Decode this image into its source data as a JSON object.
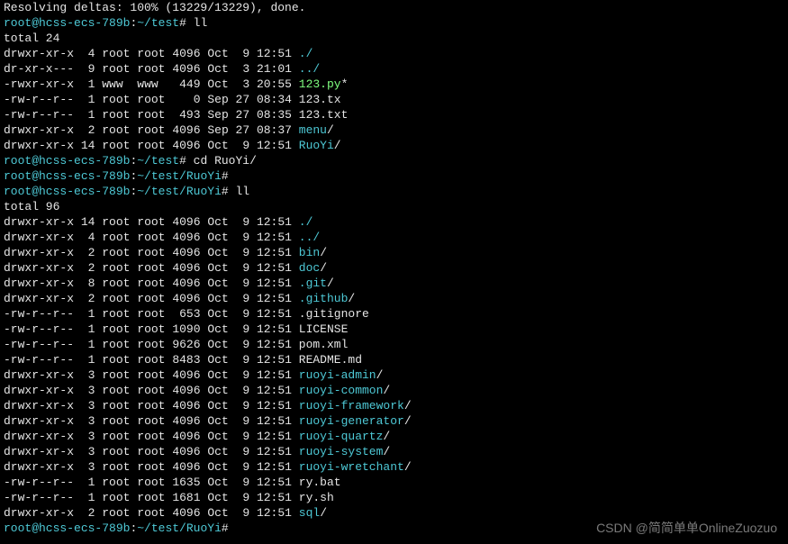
{
  "header_line": {
    "text": "Resolving deltas: 100% (13229/13229), done."
  },
  "prompt1": {
    "user": "root",
    "host": "hcss-ecs-789b",
    "path": "~/test",
    "symbol": "#",
    "cmd": "ll"
  },
  "total1": {
    "label": "total",
    "value": "24"
  },
  "listing1": [
    {
      "perm": "drwxr-xr-x",
      "links": " 4",
      "owner": "root",
      "group": "root",
      "size": "4096",
      "date": "Oct  9 12:51",
      "name": "./",
      "cls": "c-c",
      "suffix": ""
    },
    {
      "perm": "dr-xr-x---",
      "links": " 9",
      "owner": "root",
      "group": "root",
      "size": "4096",
      "date": "Oct  3 21:01",
      "name": "../",
      "cls": "c-c",
      "suffix": ""
    },
    {
      "perm": "-rwxr-xr-x",
      "links": " 1",
      "owner": "www ",
      "group": "www ",
      "size": " 449",
      "date": "Oct  3 20:55",
      "name": "123.py",
      "cls": "c-g",
      "suffix": "*"
    },
    {
      "perm": "-rw-r--r--",
      "links": " 1",
      "owner": "root",
      "group": "root",
      "size": "   0",
      "date": "Sep 27 08:34",
      "name": "123.tx",
      "cls": "c-w",
      "suffix": ""
    },
    {
      "perm": "-rw-r--r--",
      "links": " 1",
      "owner": "root",
      "group": "root",
      "size": " 493",
      "date": "Sep 27 08:35",
      "name": "123.txt",
      "cls": "c-w",
      "suffix": ""
    },
    {
      "perm": "drwxr-xr-x",
      "links": " 2",
      "owner": "root",
      "group": "root",
      "size": "4096",
      "date": "Sep 27 08:37",
      "name": "menu",
      "cls": "c-c",
      "suffix": "/"
    },
    {
      "perm": "drwxr-xr-x",
      "links": "14",
      "owner": "root",
      "group": "root",
      "size": "4096",
      "date": "Oct  9 12:51",
      "name": "RuoYi",
      "cls": "c-c",
      "suffix": "/"
    }
  ],
  "prompt2": {
    "user": "root",
    "host": "hcss-ecs-789b",
    "path": "~/test",
    "symbol": "#",
    "cmd": "cd RuoYi/"
  },
  "prompt3": {
    "user": "root",
    "host": "hcss-ecs-789b",
    "path": "~/test/RuoYi",
    "symbol": "#",
    "cmd": ""
  },
  "prompt4": {
    "user": "root",
    "host": "hcss-ecs-789b",
    "path": "~/test/RuoYi",
    "symbol": "#",
    "cmd": "ll"
  },
  "total2": {
    "label": "total",
    "value": "96"
  },
  "listing2": [
    {
      "perm": "drwxr-xr-x",
      "links": "14",
      "owner": "root",
      "group": "root",
      "size": "4096",
      "date": "Oct  9 12:51",
      "name": "./",
      "cls": "c-c",
      "suffix": ""
    },
    {
      "perm": "drwxr-xr-x",
      "links": " 4",
      "owner": "root",
      "group": "root",
      "size": "4096",
      "date": "Oct  9 12:51",
      "name": "../",
      "cls": "c-c",
      "suffix": ""
    },
    {
      "perm": "drwxr-xr-x",
      "links": " 2",
      "owner": "root",
      "group": "root",
      "size": "4096",
      "date": "Oct  9 12:51",
      "name": "bin",
      "cls": "c-c",
      "suffix": "/"
    },
    {
      "perm": "drwxr-xr-x",
      "links": " 2",
      "owner": "root",
      "group": "root",
      "size": "4096",
      "date": "Oct  9 12:51",
      "name": "doc",
      "cls": "c-c",
      "suffix": "/"
    },
    {
      "perm": "drwxr-xr-x",
      "links": " 8",
      "owner": "root",
      "group": "root",
      "size": "4096",
      "date": "Oct  9 12:51",
      "name": ".git",
      "cls": "c-c",
      "suffix": "/"
    },
    {
      "perm": "drwxr-xr-x",
      "links": " 2",
      "owner": "root",
      "group": "root",
      "size": "4096",
      "date": "Oct  9 12:51",
      "name": ".github",
      "cls": "c-c",
      "suffix": "/"
    },
    {
      "perm": "-rw-r--r--",
      "links": " 1",
      "owner": "root",
      "group": "root",
      "size": " 653",
      "date": "Oct  9 12:51",
      "name": ".gitignore",
      "cls": "c-w",
      "suffix": ""
    },
    {
      "perm": "-rw-r--r--",
      "links": " 1",
      "owner": "root",
      "group": "root",
      "size": "1090",
      "date": "Oct  9 12:51",
      "name": "LICENSE",
      "cls": "c-w",
      "suffix": ""
    },
    {
      "perm": "-rw-r--r--",
      "links": " 1",
      "owner": "root",
      "group": "root",
      "size": "9626",
      "date": "Oct  9 12:51",
      "name": "pom.xml",
      "cls": "c-w",
      "suffix": ""
    },
    {
      "perm": "-rw-r--r--",
      "links": " 1",
      "owner": "root",
      "group": "root",
      "size": "8483",
      "date": "Oct  9 12:51",
      "name": "README.md",
      "cls": "c-w",
      "suffix": ""
    },
    {
      "perm": "drwxr-xr-x",
      "links": " 3",
      "owner": "root",
      "group": "root",
      "size": "4096",
      "date": "Oct  9 12:51",
      "name": "ruoyi-admin",
      "cls": "c-c",
      "suffix": "/"
    },
    {
      "perm": "drwxr-xr-x",
      "links": " 3",
      "owner": "root",
      "group": "root",
      "size": "4096",
      "date": "Oct  9 12:51",
      "name": "ruoyi-common",
      "cls": "c-c",
      "suffix": "/"
    },
    {
      "perm": "drwxr-xr-x",
      "links": " 3",
      "owner": "root",
      "group": "root",
      "size": "4096",
      "date": "Oct  9 12:51",
      "name": "ruoyi-framework",
      "cls": "c-c",
      "suffix": "/"
    },
    {
      "perm": "drwxr-xr-x",
      "links": " 3",
      "owner": "root",
      "group": "root",
      "size": "4096",
      "date": "Oct  9 12:51",
      "name": "ruoyi-generator",
      "cls": "c-c",
      "suffix": "/"
    },
    {
      "perm": "drwxr-xr-x",
      "links": " 3",
      "owner": "root",
      "group": "root",
      "size": "4096",
      "date": "Oct  9 12:51",
      "name": "ruoyi-quartz",
      "cls": "c-c",
      "suffix": "/"
    },
    {
      "perm": "drwxr-xr-x",
      "links": " 3",
      "owner": "root",
      "group": "root",
      "size": "4096",
      "date": "Oct  9 12:51",
      "name": "ruoyi-system",
      "cls": "c-c",
      "suffix": "/"
    },
    {
      "perm": "drwxr-xr-x",
      "links": " 3",
      "owner": "root",
      "group": "root",
      "size": "4096",
      "date": "Oct  9 12:51",
      "name": "ruoyi-wretchant",
      "cls": "c-c",
      "suffix": "/"
    },
    {
      "perm": "-rw-r--r--",
      "links": " 1",
      "owner": "root",
      "group": "root",
      "size": "1635",
      "date": "Oct  9 12:51",
      "name": "ry.bat",
      "cls": "c-w",
      "suffix": ""
    },
    {
      "perm": "-rw-r--r--",
      "links": " 1",
      "owner": "root",
      "group": "root",
      "size": "1681",
      "date": "Oct  9 12:51",
      "name": "ry.sh",
      "cls": "c-w",
      "suffix": ""
    },
    {
      "perm": "drwxr-xr-x",
      "links": " 2",
      "owner": "root",
      "group": "root",
      "size": "4096",
      "date": "Oct  9 12:51",
      "name": "sql",
      "cls": "c-c",
      "suffix": "/"
    }
  ],
  "prompt5": {
    "user": "root",
    "host": "hcss-ecs-789b",
    "path": "~/test/RuoYi",
    "symbol": "#",
    "cmd": ""
  },
  "watermark": "CSDN @简简单单OnlineZuozuo"
}
